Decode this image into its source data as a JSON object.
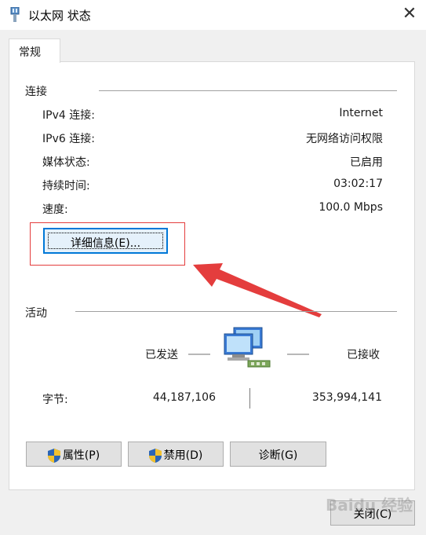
{
  "window": {
    "title": "以太网 状态",
    "close_glyph": "✕",
    "icon": "network-adapter-icon"
  },
  "tabs": [
    {
      "label": "常规"
    }
  ],
  "connection": {
    "section_title": "连接",
    "rows": [
      {
        "label": "IPv4 连接:",
        "value": "Internet"
      },
      {
        "label": "IPv6 连接:",
        "value": "无网络访问权限"
      },
      {
        "label": "媒体状态:",
        "value": "已启用"
      },
      {
        "label": "持续时间:",
        "value": "03:02:17"
      },
      {
        "label": "速度:",
        "value": "100.0 Mbps"
      }
    ],
    "details_button": "详细信息(E)..."
  },
  "activity": {
    "section_title": "活动",
    "sent_label": "已发送",
    "received_label": "已接收",
    "bytes_label": "字节:",
    "bytes_sent": "44,187,106",
    "bytes_received": "353,994,141",
    "icon": "network-computers-icon"
  },
  "buttons": {
    "properties": "属性(P)",
    "disable": "禁用(D)",
    "diagnose": "诊断(G)",
    "close": "关闭(C)"
  },
  "annotation": {
    "highlight_color": "#e43d3d"
  },
  "watermark": {
    "text": "Baidu 经验"
  }
}
